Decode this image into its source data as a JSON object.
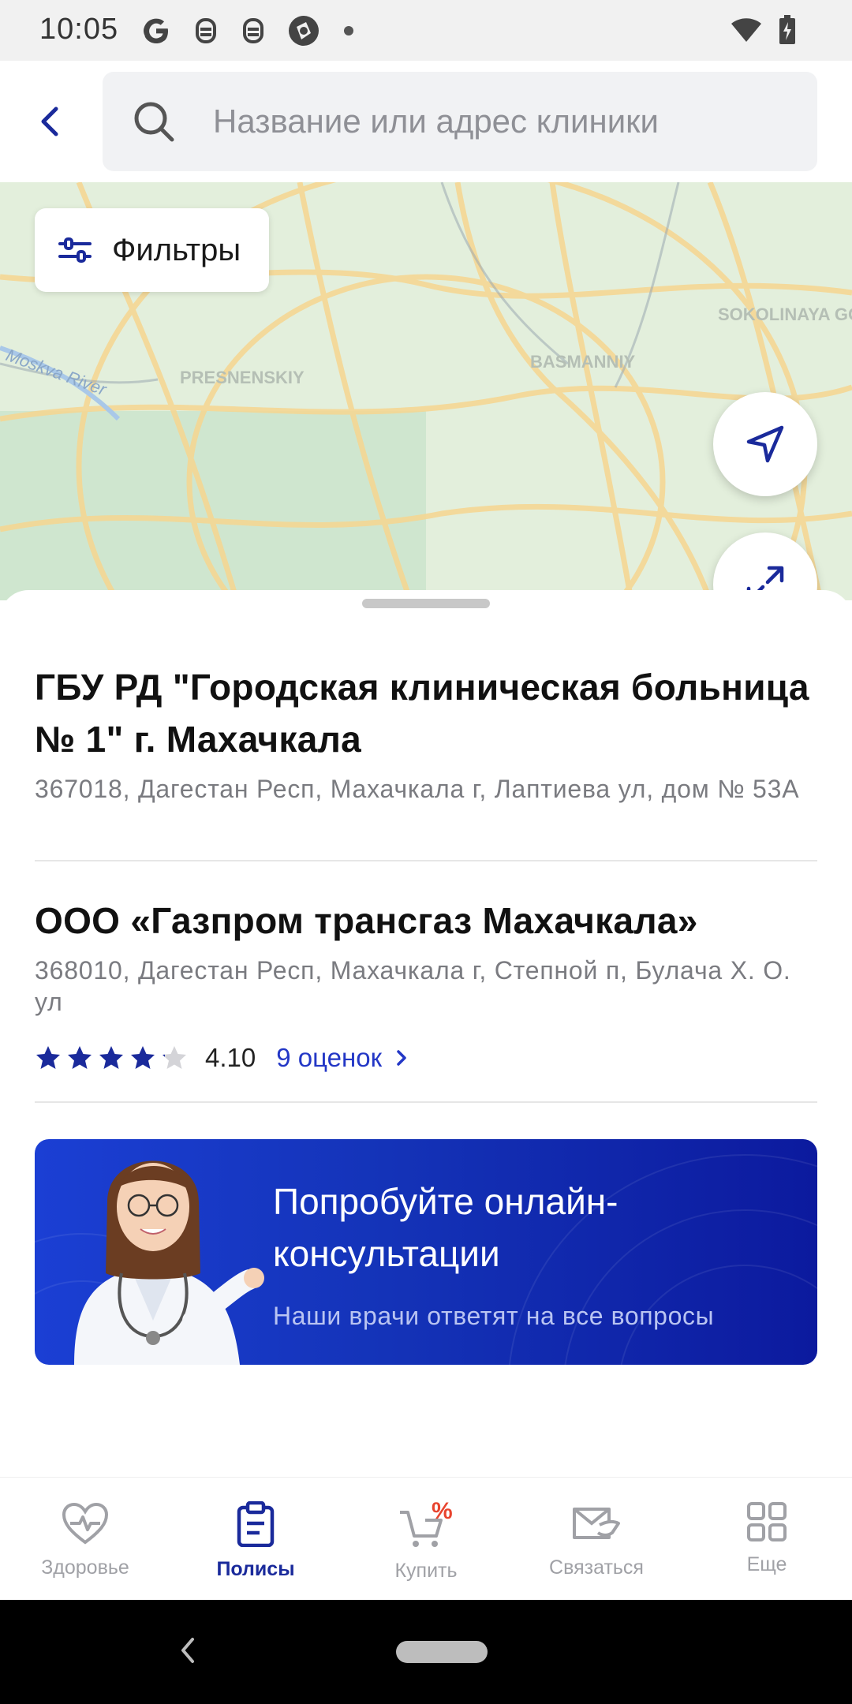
{
  "status_bar": {
    "time": "10:05",
    "left_icons": [
      "google-g-icon",
      "notification-icon",
      "notification-icon",
      "app-icon"
    ],
    "right_icons": [
      "wifi-icon",
      "battery-charging-icon"
    ]
  },
  "header": {
    "search_placeholder": "Название или адрес клиники"
  },
  "map": {
    "filters_label": "Фильтры",
    "labels": [
      "PRESNENSKIY",
      "BASMANNIY",
      "SOKOLINAYA GORA",
      "Moskva River"
    ]
  },
  "clinics": [
    {
      "title": "ГБУ РД \"Городская клиническая больница № 1\" г. Махачкала",
      "address": "367018, Дагестан Респ, Махачкала г, Лаптиева ул, дом № 53А"
    },
    {
      "title": "ООО «Газпром трансгаз Махачкала»",
      "address": "368010, Дагестан Респ, Махачкала г, Степной п, Булача Х. О. ул",
      "rating": "4.10",
      "rating_value": 4.1,
      "rating_max": 5,
      "reviews": "9 оценок"
    }
  ],
  "promo": {
    "title": "Попробуйте онлайн-консультации",
    "subtitle": "Наши врачи ответят на все вопросы"
  },
  "bottom_nav": [
    {
      "label": "Здоровье",
      "icon": "heart-pulse-icon",
      "active": false
    },
    {
      "label": "Полисы",
      "icon": "clipboard-icon",
      "active": true
    },
    {
      "label": "Купить",
      "icon": "cart-discount-icon",
      "active": false
    },
    {
      "label": "Связаться",
      "icon": "handshake-mail-icon",
      "active": false
    },
    {
      "label": "Еще",
      "icon": "grid-icon",
      "active": false
    }
  ],
  "colors": {
    "accent": "#2337c6",
    "nav_active": "#1a2a9b",
    "promo_start": "#1b3fd4",
    "promo_end": "#0c1a9e",
    "star": "#1a2a9b",
    "discount": "#e8442e"
  }
}
